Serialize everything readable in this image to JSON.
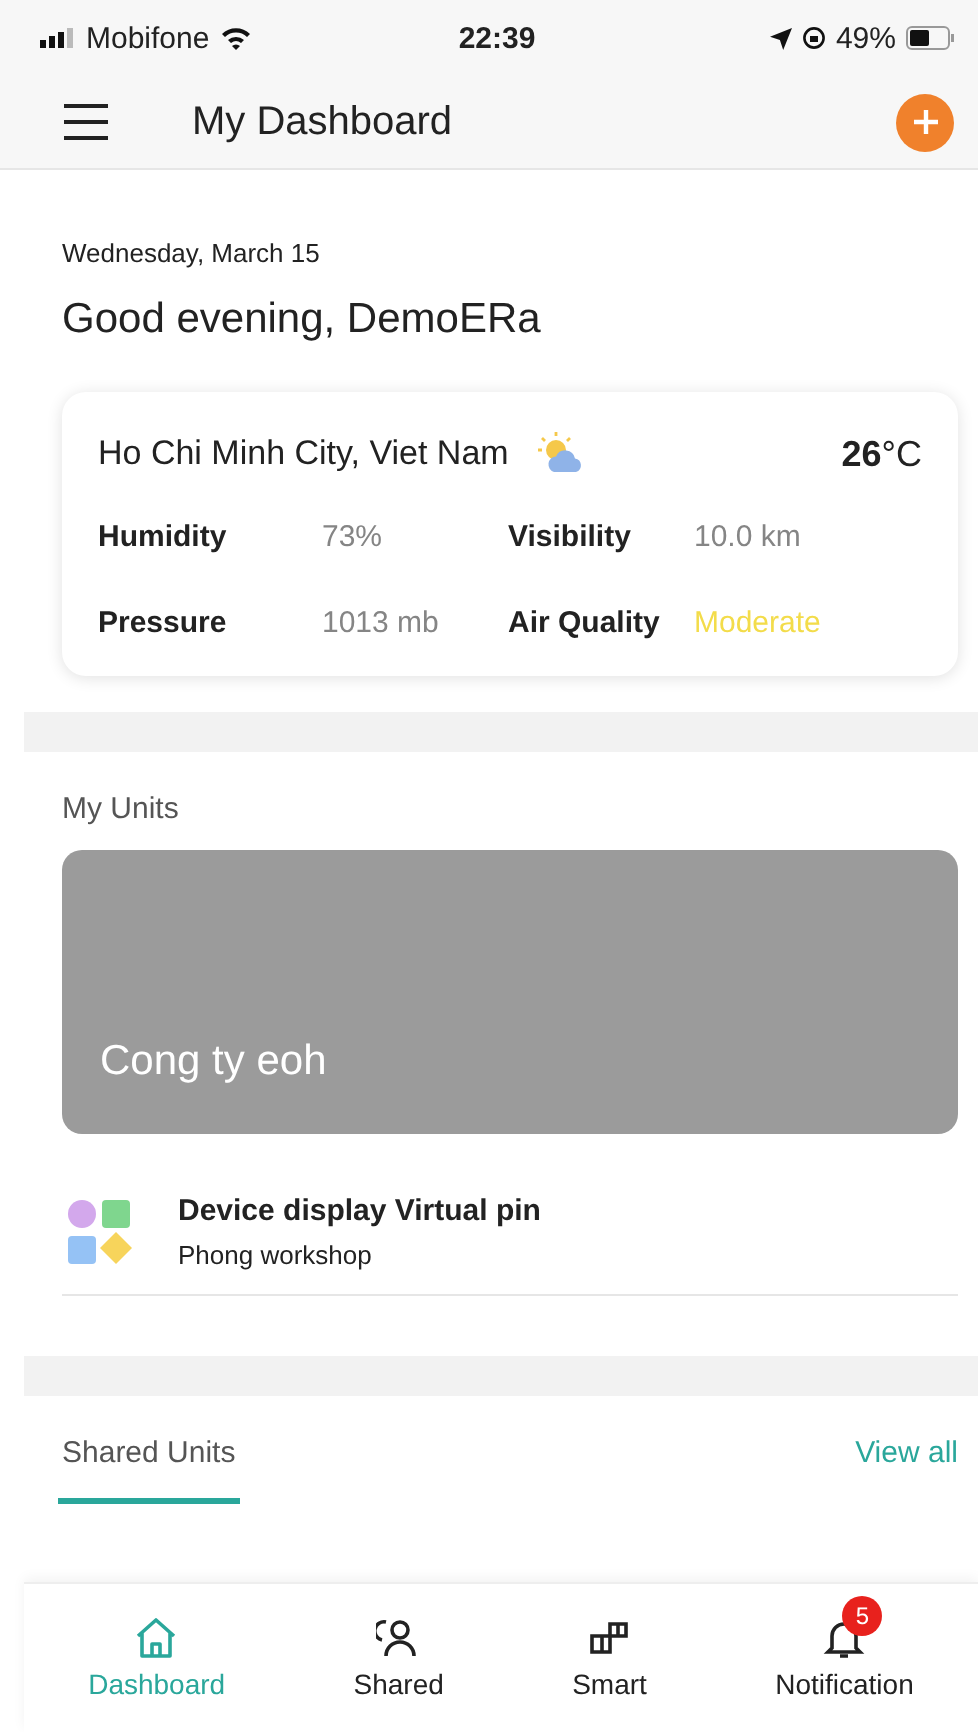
{
  "status_bar": {
    "carrier": "Mobifone",
    "time": "22:39",
    "battery": "49%"
  },
  "header": {
    "title": "My Dashboard"
  },
  "greeting": {
    "date": "Wednesday, March 15",
    "text": "Good evening, DemoERa"
  },
  "weather": {
    "location": "Ho Chi Minh City, Viet Nam",
    "temperature": "26",
    "unit": "°C",
    "stats": [
      {
        "label": "Humidity",
        "value": "73%",
        "color": "#858585"
      },
      {
        "label": "Visibility",
        "value": "10.0 km",
        "color": "#858585"
      },
      {
        "label": "Pressure",
        "value": "1013 mb",
        "color": "#858585"
      },
      {
        "label": "Air Quality",
        "value": "Moderate",
        "color": "#f3dc4a"
      }
    ]
  },
  "my_units": {
    "title": "My Units",
    "unit_card": {
      "name": "Cong ty eoh"
    },
    "devices": [
      {
        "name": "Device display Virtual pin",
        "location": "Phong workshop"
      }
    ]
  },
  "shared_units": {
    "tab": {
      "label": "Shared Units",
      "selected": true
    },
    "link": "View all"
  },
  "bottom_nav": [
    {
      "label": "Dashboard",
      "kind": "home",
      "selected": true
    },
    {
      "label": "Shared",
      "kind": "people",
      "selected": false
    },
    {
      "label": "Smart",
      "kind": "blocks",
      "selected": false
    },
    {
      "label": "Notification",
      "kind": "bell",
      "selected": false,
      "badge": "5"
    }
  ]
}
